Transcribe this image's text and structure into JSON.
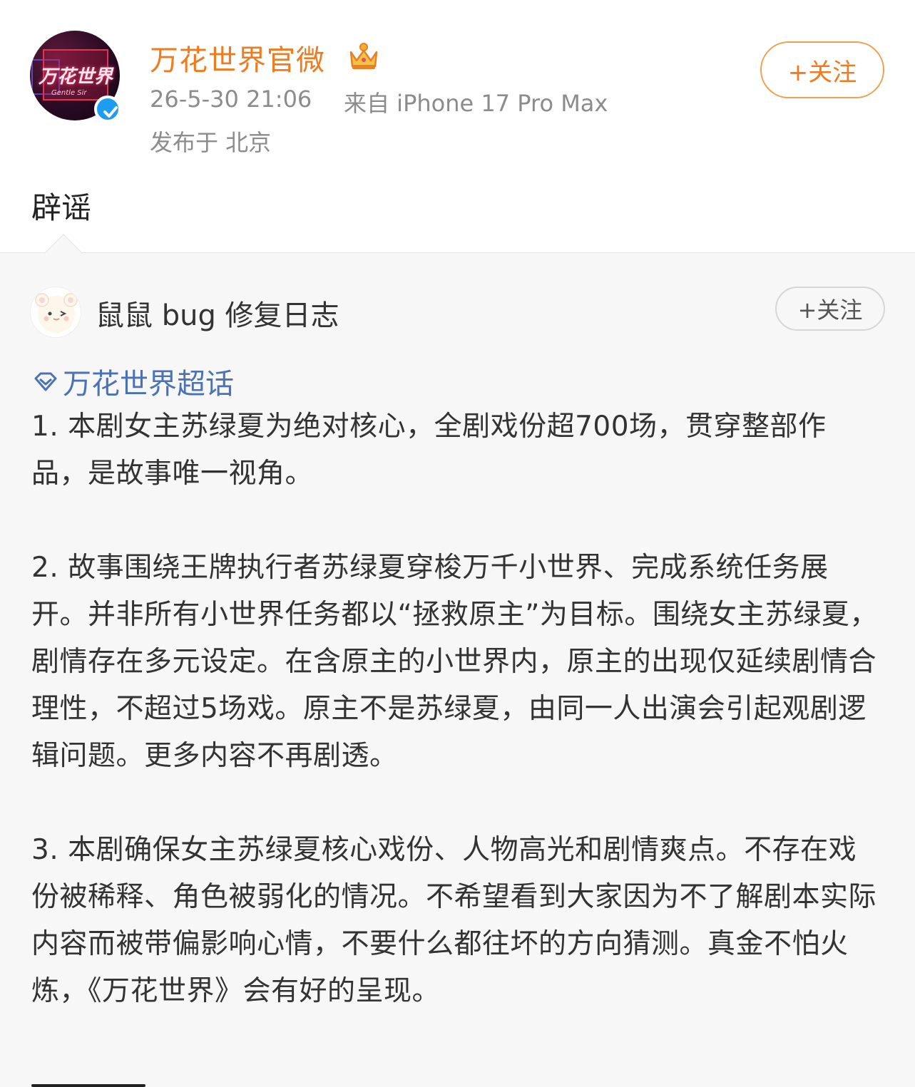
{
  "post": {
    "author": "万花世界官微",
    "avatar_text": "万花世界",
    "avatar_sub": "Gentle Sir",
    "time": "26-5-30 21:06",
    "source": "来自 iPhone 17 Pro Max",
    "location": "发布于 北京",
    "follow_label": "+关注",
    "text": "辟谣"
  },
  "repost": {
    "author": "鼠鼠 bug 修复日志",
    "follow_label": "+关注",
    "topic": "万花世界超话",
    "paragraphs": [
      "1. 本剧女主苏绿夏为绝对核心，全剧戏份超700场，贯穿整部作品，是故事唯一视角。",
      "2. 故事围绕王牌执行者苏绿夏穿梭万千小世界、完成系统任务展开。并非所有小世界任务都以“拯救原主”为目标。围绕女主苏绿夏，剧情存在多元设定。在含原主的小世界内，原主的出现仅延续剧情合理性，不超过5场戏。原主不是苏绿夏，由同一人出演会引起观剧逻辑问题。更多内容不再剧透。",
      "3. 本剧确保女主苏绿夏核心戏份、人物高光和剧情爽点。不存在戏份被稀释、角色被弱化的情况。不希望看到大家因为不了解剧本实际内容而被带偏影响心情，不要什么都往坏的方向猜测。真金不怕火炼，《万花世界》会有好的呈现。"
    ]
  },
  "colors": {
    "accent_orange": "#f07b1f",
    "topic_blue": "#4a73b5",
    "verified_blue": "#1e9cf0"
  },
  "icons": [
    "verified-icon",
    "crown-icon",
    "diamond-icon"
  ]
}
